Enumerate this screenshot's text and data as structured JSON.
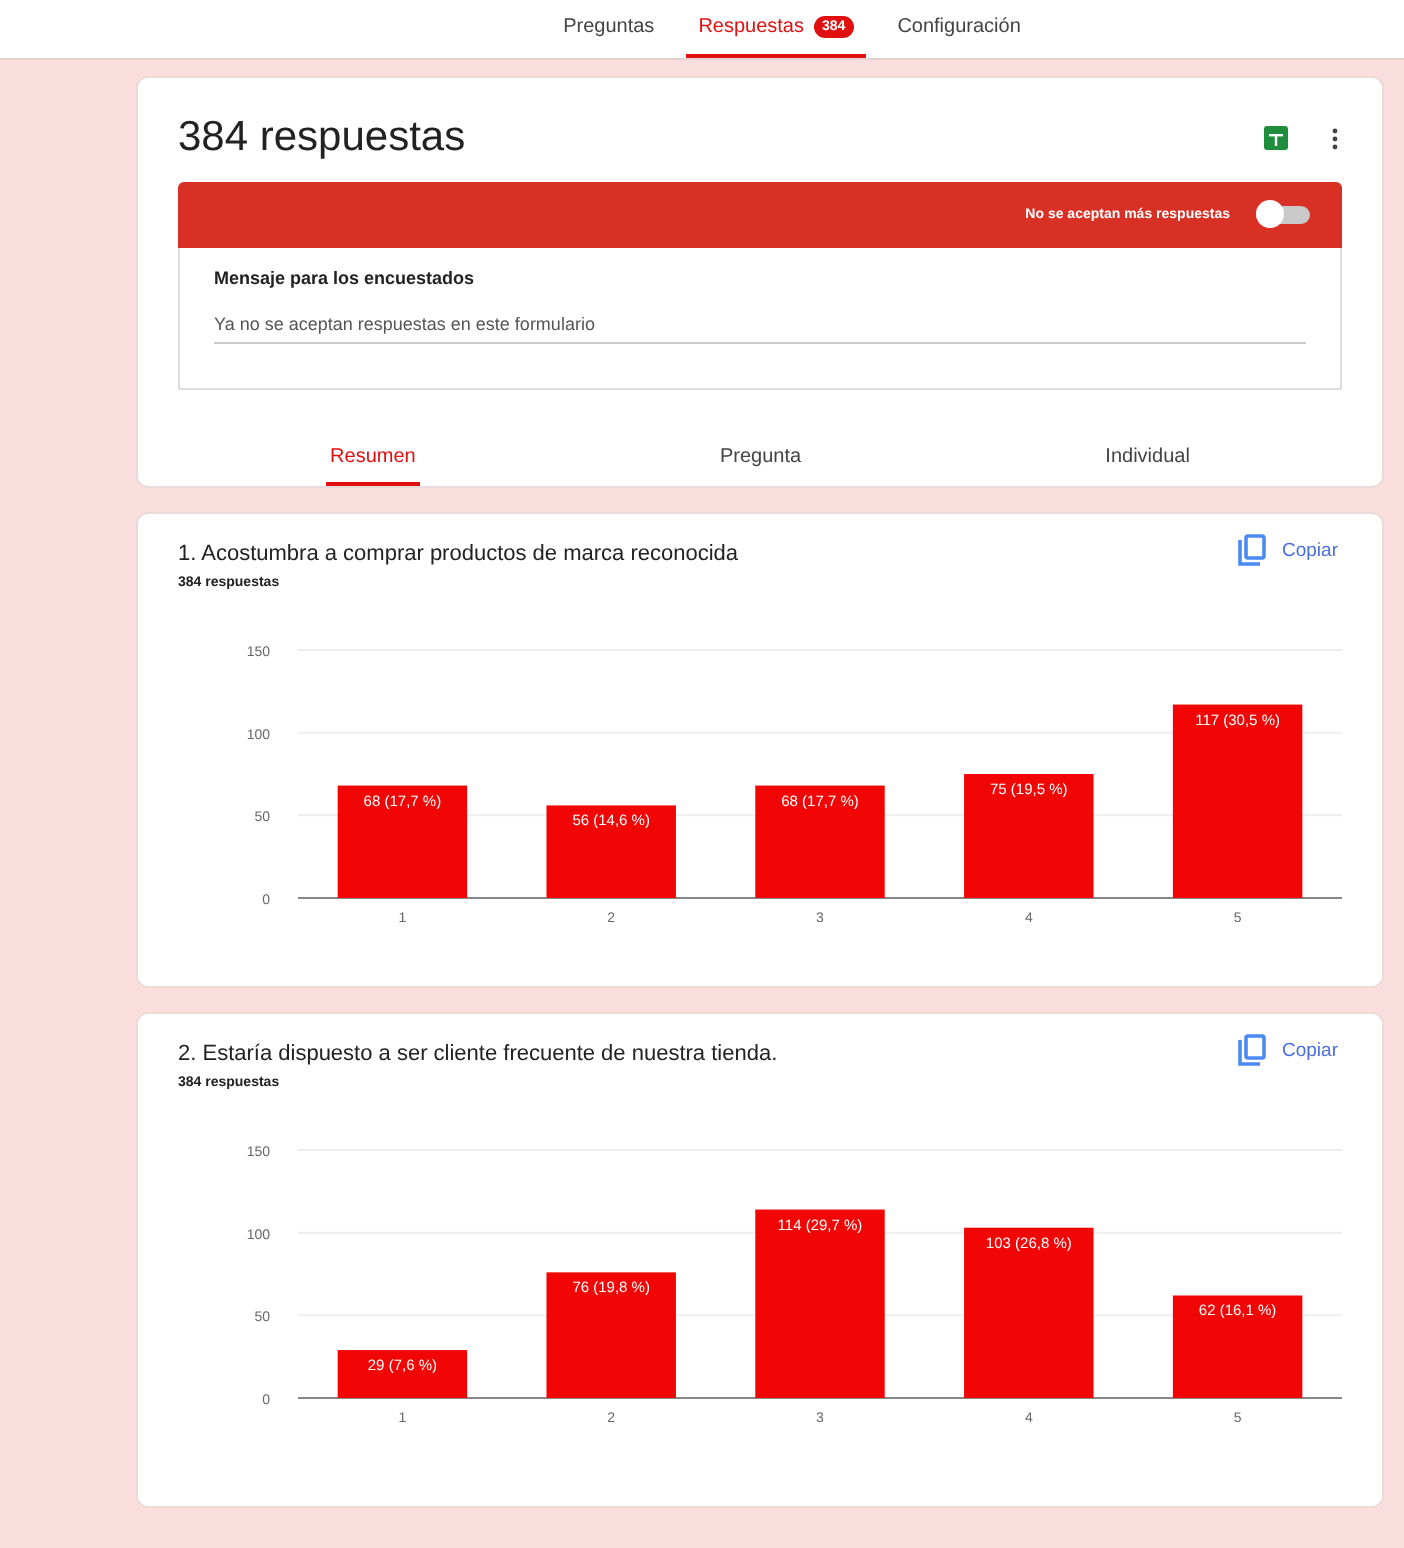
{
  "tabs": [
    {
      "label": "Preguntas",
      "selected": false
    },
    {
      "label": "Respuestas",
      "selected": true,
      "badge": "384"
    },
    {
      "label": "Configuración",
      "selected": false
    }
  ],
  "summary": {
    "title": "384 respuestas",
    "banner": {
      "label": "No se aceptan más respuestas",
      "on": false
    },
    "message": {
      "label": "Mensaje para los encuestados",
      "value": "Ya no se aceptan respuestas en este formulario"
    },
    "views": [
      {
        "label": "Resumen",
        "selected": true
      },
      {
        "label": "Pregunta",
        "selected": false
      },
      {
        "label": "Individual",
        "selected": false
      }
    ]
  },
  "questions": [
    {
      "title": "1.  Acostumbra a comprar productos de marca reconocida",
      "count": "384 respuestas",
      "copy": "Copiar",
      "chart_data": {
        "type": "bar",
        "categories": [
          "1",
          "2",
          "3",
          "4",
          "5"
        ],
        "ylim": [
          0,
          150
        ],
        "yticks": [
          0,
          50,
          100,
          150
        ],
        "series": [
          {
            "color": "#f20505",
            "values": [
              68,
              56,
              68,
              75,
              117
            ]
          }
        ],
        "value_labels": [
          "68 (17,7 %)",
          "56 (14,6 %)",
          "68 (17,7 %)",
          "75 (19,5 %)",
          "117 (30,5 %)"
        ]
      }
    },
    {
      "title": "2.  Estaría dispuesto a ser cliente frecuente de nuestra tienda.",
      "count": "384 respuestas",
      "copy": "Copiar",
      "chart_data": {
        "type": "bar",
        "categories": [
          "1",
          "2",
          "3",
          "4",
          "5"
        ],
        "ylim": [
          0,
          150
        ],
        "yticks": [
          0,
          50,
          100,
          150
        ],
        "series": [
          {
            "color": "#f20505",
            "values": [
              29,
              76,
              114,
              103,
              62
            ]
          }
        ],
        "value_labels": [
          "29 (7,6 %)",
          "76 (19,8 %)",
          "114 (29,7 %)",
          "103 (26,8 %)",
          "62 (16,1 %)"
        ]
      }
    }
  ]
}
